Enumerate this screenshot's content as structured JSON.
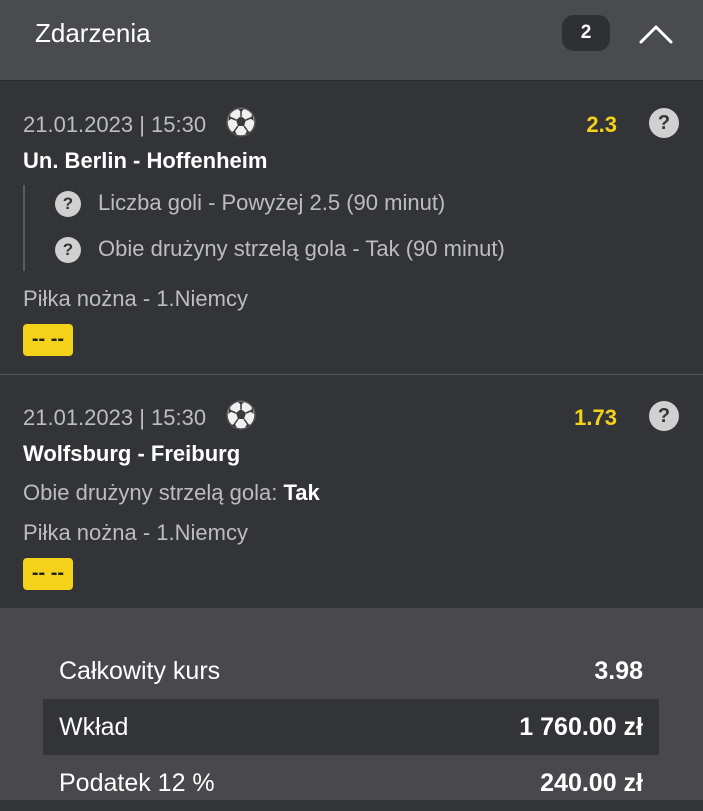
{
  "header": {
    "title": "Zdarzenia",
    "count": "2"
  },
  "events": [
    {
      "datetime": "21.01.2023 | 15:30",
      "odds": "2.3",
      "match": "Un. Berlin - Hoffenheim",
      "selections": [
        "Liczba goli - Powyżej 2.5 (90 minut)",
        "Obie drużyny strzelą gola - Tak (90 minut)"
      ],
      "league": "Piłka nożna - 1.Niemcy",
      "status": "-- --"
    },
    {
      "datetime": "21.01.2023 | 15:30",
      "odds": "1.73",
      "match": "Wolfsburg - Freiburg",
      "market_label": "Obie drużyny strzelą gola:",
      "market_value": "Tak",
      "league": "Piłka nożna - 1.Niemcy",
      "status": "-- --"
    }
  ],
  "summary": {
    "total_odds_label": "Całkowity kurs",
    "total_odds_value": "3.98",
    "stake_label": "Wkład",
    "stake_value": "1 760.00 zł",
    "tax_label": "Podatek 12 %",
    "tax_value": "240.00 zł"
  },
  "icons": {
    "sport": "soccer-ball-icon",
    "help": "question-icon",
    "collapse": "chevron-up-icon"
  },
  "colors": {
    "odds": "#f4d21a",
    "status_badge": "#f4d21a",
    "background": "#333438",
    "header": "#4a4b4f"
  }
}
